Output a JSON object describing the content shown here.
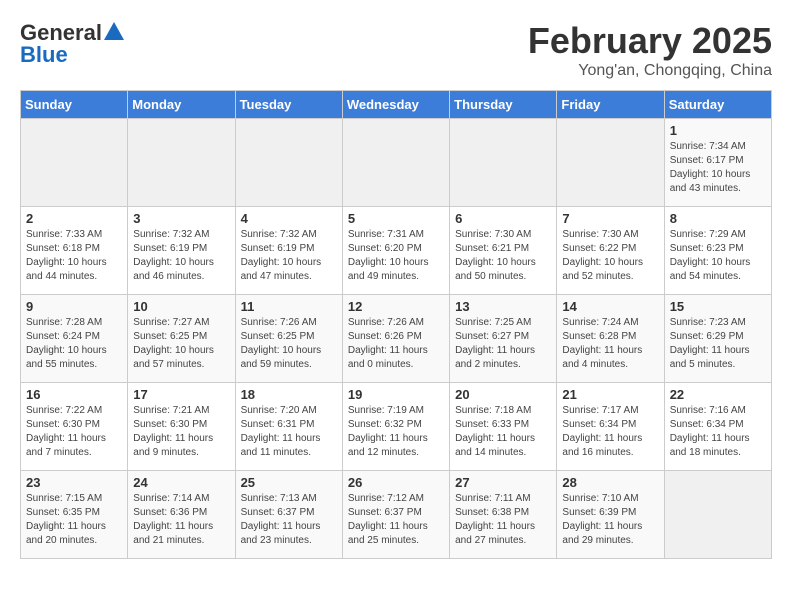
{
  "logo": {
    "general": "General",
    "blue": "Blue"
  },
  "header": {
    "title": "February 2025",
    "subtitle": "Yong'an, Chongqing, China"
  },
  "days_of_week": [
    "Sunday",
    "Monday",
    "Tuesday",
    "Wednesday",
    "Thursday",
    "Friday",
    "Saturday"
  ],
  "weeks": [
    [
      {
        "day": "",
        "info": ""
      },
      {
        "day": "",
        "info": ""
      },
      {
        "day": "",
        "info": ""
      },
      {
        "day": "",
        "info": ""
      },
      {
        "day": "",
        "info": ""
      },
      {
        "day": "",
        "info": ""
      },
      {
        "day": "1",
        "info": "Sunrise: 7:34 AM\nSunset: 6:17 PM\nDaylight: 10 hours\nand 43 minutes."
      }
    ],
    [
      {
        "day": "2",
        "info": "Sunrise: 7:33 AM\nSunset: 6:18 PM\nDaylight: 10 hours\nand 44 minutes."
      },
      {
        "day": "3",
        "info": "Sunrise: 7:32 AM\nSunset: 6:19 PM\nDaylight: 10 hours\nand 46 minutes."
      },
      {
        "day": "4",
        "info": "Sunrise: 7:32 AM\nSunset: 6:19 PM\nDaylight: 10 hours\nand 47 minutes."
      },
      {
        "day": "5",
        "info": "Sunrise: 7:31 AM\nSunset: 6:20 PM\nDaylight: 10 hours\nand 49 minutes."
      },
      {
        "day": "6",
        "info": "Sunrise: 7:30 AM\nSunset: 6:21 PM\nDaylight: 10 hours\nand 50 minutes."
      },
      {
        "day": "7",
        "info": "Sunrise: 7:30 AM\nSunset: 6:22 PM\nDaylight: 10 hours\nand 52 minutes."
      },
      {
        "day": "8",
        "info": "Sunrise: 7:29 AM\nSunset: 6:23 PM\nDaylight: 10 hours\nand 54 minutes."
      }
    ],
    [
      {
        "day": "9",
        "info": "Sunrise: 7:28 AM\nSunset: 6:24 PM\nDaylight: 10 hours\nand 55 minutes."
      },
      {
        "day": "10",
        "info": "Sunrise: 7:27 AM\nSunset: 6:25 PM\nDaylight: 10 hours\nand 57 minutes."
      },
      {
        "day": "11",
        "info": "Sunrise: 7:26 AM\nSunset: 6:25 PM\nDaylight: 10 hours\nand 59 minutes."
      },
      {
        "day": "12",
        "info": "Sunrise: 7:26 AM\nSunset: 6:26 PM\nDaylight: 11 hours\nand 0 minutes."
      },
      {
        "day": "13",
        "info": "Sunrise: 7:25 AM\nSunset: 6:27 PM\nDaylight: 11 hours\nand 2 minutes."
      },
      {
        "day": "14",
        "info": "Sunrise: 7:24 AM\nSunset: 6:28 PM\nDaylight: 11 hours\nand 4 minutes."
      },
      {
        "day": "15",
        "info": "Sunrise: 7:23 AM\nSunset: 6:29 PM\nDaylight: 11 hours\nand 5 minutes."
      }
    ],
    [
      {
        "day": "16",
        "info": "Sunrise: 7:22 AM\nSunset: 6:30 PM\nDaylight: 11 hours\nand 7 minutes."
      },
      {
        "day": "17",
        "info": "Sunrise: 7:21 AM\nSunset: 6:30 PM\nDaylight: 11 hours\nand 9 minutes."
      },
      {
        "day": "18",
        "info": "Sunrise: 7:20 AM\nSunset: 6:31 PM\nDaylight: 11 hours\nand 11 minutes."
      },
      {
        "day": "19",
        "info": "Sunrise: 7:19 AM\nSunset: 6:32 PM\nDaylight: 11 hours\nand 12 minutes."
      },
      {
        "day": "20",
        "info": "Sunrise: 7:18 AM\nSunset: 6:33 PM\nDaylight: 11 hours\nand 14 minutes."
      },
      {
        "day": "21",
        "info": "Sunrise: 7:17 AM\nSunset: 6:34 PM\nDaylight: 11 hours\nand 16 minutes."
      },
      {
        "day": "22",
        "info": "Sunrise: 7:16 AM\nSunset: 6:34 PM\nDaylight: 11 hours\nand 18 minutes."
      }
    ],
    [
      {
        "day": "23",
        "info": "Sunrise: 7:15 AM\nSunset: 6:35 PM\nDaylight: 11 hours\nand 20 minutes."
      },
      {
        "day": "24",
        "info": "Sunrise: 7:14 AM\nSunset: 6:36 PM\nDaylight: 11 hours\nand 21 minutes."
      },
      {
        "day": "25",
        "info": "Sunrise: 7:13 AM\nSunset: 6:37 PM\nDaylight: 11 hours\nand 23 minutes."
      },
      {
        "day": "26",
        "info": "Sunrise: 7:12 AM\nSunset: 6:37 PM\nDaylight: 11 hours\nand 25 minutes."
      },
      {
        "day": "27",
        "info": "Sunrise: 7:11 AM\nSunset: 6:38 PM\nDaylight: 11 hours\nand 27 minutes."
      },
      {
        "day": "28",
        "info": "Sunrise: 7:10 AM\nSunset: 6:39 PM\nDaylight: 11 hours\nand 29 minutes."
      },
      {
        "day": "",
        "info": ""
      }
    ]
  ]
}
